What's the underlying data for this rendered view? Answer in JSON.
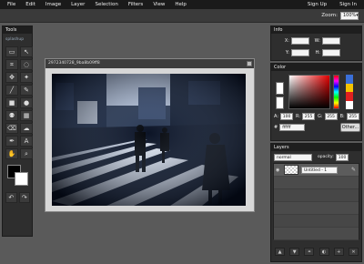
{
  "menu": {
    "items": [
      "File",
      "Edit",
      "Image",
      "Layer",
      "Selection",
      "Filters",
      "View",
      "Help"
    ],
    "right": [
      "Sign Up",
      "Sign In"
    ]
  },
  "zoom": {
    "label": "Zoom:",
    "value": "100%"
  },
  "tools": {
    "title": "Tools",
    "brand": "splashup",
    "icons": [
      "marquee-icon",
      "move-icon",
      "crop-icon",
      "lasso-icon",
      "transform-icon",
      "magic-wand-icon",
      "brush-icon",
      "pencil-icon",
      "rectangle-icon",
      "ellipse-icon",
      "clone-icon",
      "gradient-icon",
      "eraser-icon",
      "smudge-icon",
      "dropper-icon",
      "text-icon",
      "hand-icon",
      "zoom-icon"
    ],
    "glyphs": [
      "▭",
      "↖",
      "⌗",
      "◌",
      "✥",
      "✦",
      "╱",
      "✎",
      "■",
      "●",
      "⚉",
      "▦",
      "⌫",
      "☁",
      "✒",
      "A",
      "✋",
      "⌕"
    ],
    "fg_color": "#000000",
    "bg_color": "#ffffff"
  },
  "document": {
    "title": "2972340728_9ba8b09ff8"
  },
  "info": {
    "title": "Info",
    "x_label": "X:",
    "y_label": "Y:",
    "w_label": "W:",
    "h_label": "H:",
    "x": "",
    "y": "",
    "w": "",
    "h": ""
  },
  "color": {
    "title": "Color",
    "a_label": "A:",
    "a": "100",
    "r_label": "R:",
    "r": "255",
    "g_label": "G:",
    "g": "255",
    "b_label": "B:",
    "b": "255",
    "hex_label": "#",
    "hex": "ffffff",
    "other_label": "Other...",
    "palette": [
      "#3a6fd8",
      "#f4c400",
      "#e02020",
      "#ffffff"
    ]
  },
  "layers": {
    "title": "Layers",
    "blend_mode": "normal",
    "opacity_label": "opacity:",
    "opacity": "100",
    "items": [
      {
        "name": "Untitled - 1"
      }
    ],
    "footer_icons": [
      "move-up-icon",
      "move-down-icon",
      "link-icon",
      "adjust-icon",
      "new-layer-icon",
      "delete-layer-icon"
    ],
    "footer_glyphs": [
      "▲",
      "▼",
      "⚭",
      "◐",
      "+",
      "✕"
    ]
  }
}
